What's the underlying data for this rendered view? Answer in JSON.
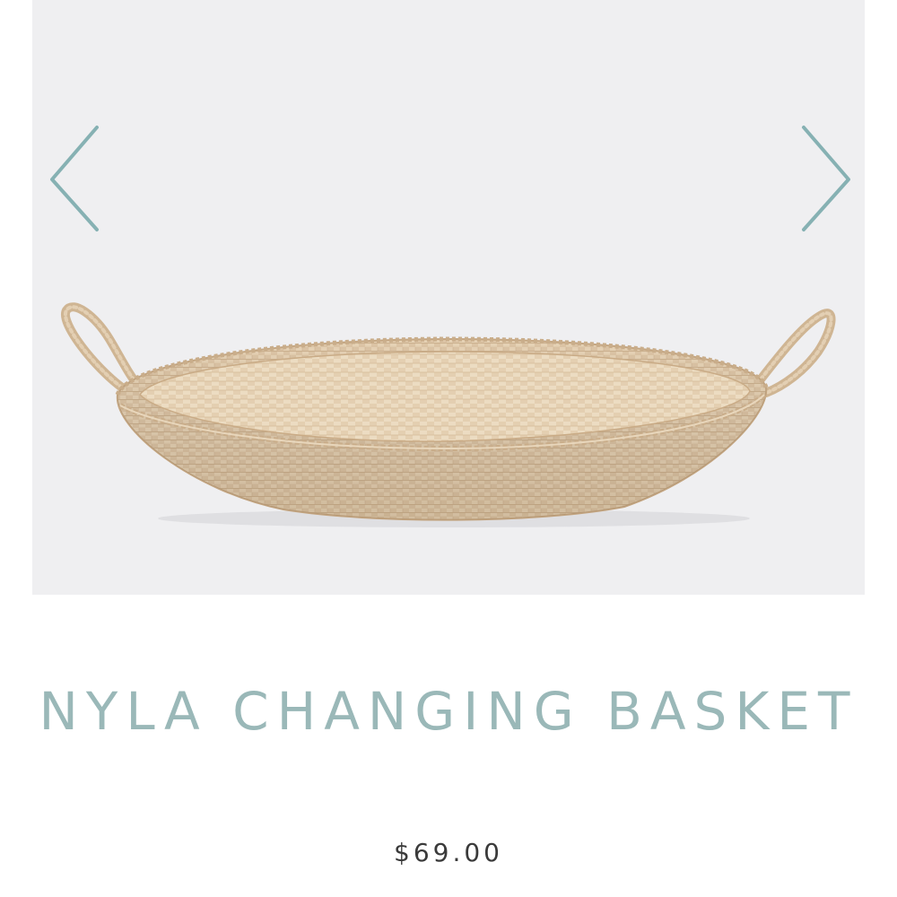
{
  "product": {
    "title": "NYLA CHANGING BASKET",
    "price": "$69.00",
    "image_subject": "woven seagrass changing basket with handles"
  },
  "gallery": {
    "prev_icon": "chevron-left-icon",
    "next_icon": "chevron-right-icon"
  },
  "colors": {
    "accent": "#86b1b3",
    "title": "#9ab8b8",
    "price": "#3a3a3a",
    "image_background": "#efeff1",
    "basket": "#dcc4a5"
  }
}
